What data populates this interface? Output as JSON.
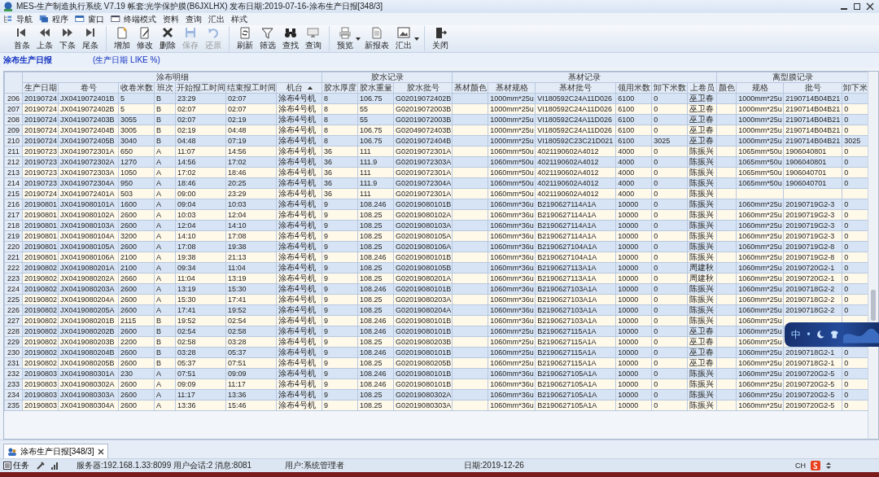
{
  "window": {
    "title": "MES-生产制造执行系统 V7.19 帐套:光学保护膜(B6JXLHX) 发布日期:2019-07-16-涂布生产日报[348/3]"
  },
  "menu": [
    "导航",
    "程序",
    "窗口",
    "终端模式",
    "资料",
    "查询",
    "汇出",
    "样式"
  ],
  "toolbar": [
    {
      "items": [
        {
          "label": "首条",
          "disabled": false,
          "dropdown": false
        },
        {
          "label": "上条",
          "disabled": false,
          "dropdown": false
        },
        {
          "label": "下条",
          "disabled": false,
          "dropdown": false
        },
        {
          "label": "尾条",
          "disabled": false,
          "dropdown": false
        }
      ]
    },
    {
      "items": [
        {
          "label": "增加",
          "disabled": false,
          "dropdown": false
        },
        {
          "label": "修改",
          "disabled": false,
          "dropdown": false
        },
        {
          "label": "删除",
          "disabled": false,
          "dropdown": false
        },
        {
          "label": "保存",
          "disabled": true,
          "dropdown": false
        },
        {
          "label": "还原",
          "disabled": true,
          "dropdown": false
        }
      ]
    },
    {
      "items": [
        {
          "label": "刷新",
          "disabled": false,
          "dropdown": false
        },
        {
          "label": "筛选",
          "disabled": false,
          "dropdown": false
        },
        {
          "label": "查找",
          "disabled": false,
          "dropdown": false
        },
        {
          "label": "查询",
          "disabled": false,
          "dropdown": false
        }
      ]
    },
    {
      "items": [
        {
          "label": "预览",
          "disabled": false,
          "dropdown": true
        },
        {
          "label": "新报表",
          "disabled": false,
          "dropdown": false
        },
        {
          "label": "汇出",
          "disabled": false,
          "dropdown": true
        }
      ]
    },
    {
      "items": [
        {
          "label": "关闭",
          "disabled": false,
          "dropdown": false
        }
      ]
    }
  ],
  "report": {
    "title": "涂布生产日报",
    "filter": "(生产日期 LIKE %)"
  },
  "table": {
    "groups": [
      {
        "label": "涂布明细",
        "columns": [
          {
            "label": "生产日期",
            "sorted": false
          },
          {
            "label": "卷号",
            "sorted": false
          },
          {
            "label": "收卷米数",
            "sorted": false
          },
          {
            "label": "班次",
            "sorted": false
          },
          {
            "label": "开始报工时间",
            "sorted": false
          },
          {
            "label": "结束报工时间",
            "sorted": false
          },
          {
            "label": "机台",
            "sorted": true
          }
        ]
      },
      {
        "label": "胶水记录",
        "columns": [
          {
            "label": "胶水厚度",
            "sorted": false
          },
          {
            "label": "胶水重量",
            "sorted": false
          },
          {
            "label": "胶水批号",
            "sorted": false
          }
        ]
      },
      {
        "label": "基材记录",
        "columns": [
          {
            "label": "基材颜色",
            "sorted": false
          },
          {
            "label": "基材规格",
            "sorted": false
          },
          {
            "label": "基材批号",
            "sorted": false
          },
          {
            "label": "领用米数",
            "sorted": false
          },
          {
            "label": "卸下米数",
            "sorted": false
          },
          {
            "label": "上卷员",
            "sorted": false
          }
        ]
      },
      {
        "label": "离型膜记录",
        "columns": [
          {
            "label": "颜色",
            "sorted": false
          },
          {
            "label": "规格",
            "sorted": false
          },
          {
            "label": "批号",
            "sorted": false
          },
          {
            "label": "卸下米",
            "sorted": false
          }
        ]
      }
    ],
    "rows": [
      {
        "n": "206",
        "cells": [
          "20190724",
          "JX0419072401B",
          "5",
          "B",
          "23:29",
          "02:07",
          "涂布4号机",
          "8",
          "106.75",
          "G02019072402B",
          null,
          "1000mm*25u",
          "VI180592C24A11D026",
          "6100",
          "0",
          "巫卫春",
          null,
          "1000mm*25u",
          "2190714B04B21",
          "0"
        ]
      },
      {
        "n": "207",
        "cells": [
          "20190724",
          "JX0419072402B",
          "5",
          "B",
          "02:07",
          "02:07",
          "涂布4号机",
          "8",
          "55",
          "G02019072003B",
          null,
          "1000mm*25u",
          "VI180592C24A11D026",
          "6100",
          "0",
          "巫卫春",
          null,
          "1000mm*25u",
          "2190714B04B21",
          "0"
        ]
      },
      {
        "n": "208",
        "cells": [
          "20190724",
          "JX0419072403B",
          "3055",
          "B",
          "02:07",
          "02:19",
          "涂布4号机",
          "8",
          "55",
          "G02019072003B",
          null,
          "1000mm*25u",
          "VI180592C24A11D026",
          "6100",
          "0",
          "巫卫春",
          null,
          "1000mm*25u",
          "2190714B04B21",
          "0"
        ]
      },
      {
        "n": "209",
        "cells": [
          "20190724",
          "JX0419072404B",
          "3005",
          "B",
          "02:19",
          "04:48",
          "涂布4号机",
          "8",
          "106.75",
          "G02049072403B",
          null,
          "1000mm*25u",
          "VI180592C24A11D026",
          "6100",
          "0",
          "巫卫春",
          null,
          "1000mm*25u",
          "2190714B04B21",
          "0"
        ]
      },
      {
        "n": "210",
        "cells": [
          "20190724",
          "JX0419072405B",
          "3040",
          "B",
          "04:48",
          "07:19",
          "涂布4号机",
          "8",
          "106.75",
          "G02019072404B",
          null,
          "1000mm*25u",
          "VI180592C23C21D021",
          "6100",
          "3025",
          "巫卫春",
          null,
          "1000mm*25u",
          "2190714B04B21",
          "3025"
        ]
      },
      {
        "n": "211",
        "cells": [
          "20190723",
          "JX0419072301A",
          "650",
          "A",
          "11:07",
          "14:56",
          "涂布4号机",
          "36",
          "111",
          "G02019072301A",
          null,
          "1060mm*50u",
          "4021190602A4012",
          "4000",
          "0",
          "陈振兴",
          null,
          "1065mm*50u",
          "1906040801",
          "0"
        ]
      },
      {
        "n": "212",
        "cells": [
          "20190723",
          "JX0419072302A",
          "1270",
          "A",
          "14:56",
          "17:02",
          "涂布4号机",
          "36",
          "111.9",
          "G02019072303A",
          null,
          "1060mm*50u",
          "4021190602A4012",
          "4000",
          "0",
          "陈振兴",
          null,
          "1065mm*50u",
          "1906040801",
          "0"
        ]
      },
      {
        "n": "213",
        "cells": [
          "20190723",
          "JX0419072303A",
          "1050",
          "A",
          "17:02",
          "18:46",
          "涂布4号机",
          "36",
          "111",
          "G02019072301A",
          null,
          "1060mm*50u",
          "4021190602A4012",
          "4000",
          "0",
          "陈振兴",
          null,
          "1065mm*50u",
          "1906040701",
          "0"
        ]
      },
      {
        "n": "214",
        "cells": [
          "20190723",
          "JX0419072304A",
          "950",
          "A",
          "18:46",
          "20:25",
          "涂布4号机",
          "36",
          "111.9",
          "G02019072304A",
          null,
          "1060mm*50u",
          "4021190602A4012",
          "4000",
          "0",
          "陈振兴",
          null,
          "1065mm*50u",
          "1906040701",
          "0"
        ]
      },
      {
        "n": "215",
        "cells": [
          "20190724",
          "JX0419072401A",
          "503",
          "A",
          "09:00",
          "23:29",
          "涂布4号机",
          "36",
          "111",
          "G02019072301A",
          null,
          "1060mm*50u",
          "4021190602A4012",
          "4000",
          "0",
          "陈振兴",
          null,
          null,
          null,
          null
        ]
      },
      {
        "n": "216",
        "cells": [
          "20190801",
          "JX0419080101A",
          "1600",
          "A",
          "09:04",
          "10:03",
          "涂布4号机",
          "9",
          "108.246",
          "G02019080101B",
          null,
          "1060mm*36u",
          "B2190627114A1A",
          "10000",
          "0",
          "陈振兴",
          null,
          "1060mm*25u",
          "20190719G2-3",
          "0"
        ]
      },
      {
        "n": "217",
        "cells": [
          "20190801",
          "JX0419080102A",
          "2600",
          "A",
          "10:03",
          "12:04",
          "涂布4号机",
          "9",
          "108.25",
          "G02019080102A",
          null,
          "1060mm*36u",
          "B2190627114A1A",
          "10000",
          "0",
          "陈振兴",
          null,
          "1060mm*25u",
          "20190719G2-3",
          "0"
        ]
      },
      {
        "n": "218",
        "cells": [
          "20190801",
          "JX0419080103A",
          "2600",
          "A",
          "12:04",
          "14:10",
          "涂布4号机",
          "9",
          "108.25",
          "G02019080103A",
          null,
          "1060mm*36u",
          "B2190627114A1A",
          "10000",
          "0",
          "陈振兴",
          null,
          "1060mm*25u",
          "20190719G2-3",
          "0"
        ]
      },
      {
        "n": "219",
        "cells": [
          "20190801",
          "JX0419080104A",
          "3200",
          "A",
          "14:10",
          "17:08",
          "涂布4号机",
          "9",
          "108.25",
          "G02019080105A",
          null,
          "1060mm*36u",
          "B2190627114A1A",
          "10000",
          "0",
          "陈振兴",
          null,
          "1060mm*25u",
          "20190719G2-3",
          "0"
        ]
      },
      {
        "n": "220",
        "cells": [
          "20190801",
          "JX0419080105A",
          "2600",
          "A",
          "17:08",
          "19:38",
          "涂布4号机",
          "9",
          "108.25",
          "G02019080106A",
          null,
          "1060mm*36u",
          "B2190627104A1A",
          "10000",
          "0",
          "陈振兴",
          null,
          "1060mm*25u",
          "20190719G2-8",
          "0"
        ]
      },
      {
        "n": "221",
        "cells": [
          "20190801",
          "JX0419080106A",
          "2100",
          "A",
          "19:38",
          "21:13",
          "涂布4号机",
          "9",
          "108.246",
          "G02019080101B",
          null,
          "1060mm*36u",
          "B2190627104A1A",
          "10000",
          "0",
          "陈振兴",
          null,
          "1060mm*25u",
          "20190719G2-8",
          "0"
        ]
      },
      {
        "n": "222",
        "cells": [
          "20190802",
          "JX0419080201A",
          "2100",
          "A",
          "09:34",
          "11:04",
          "涂布4号机",
          "9",
          "108.25",
          "G02019080105B",
          null,
          "1060mm*36u",
          "B2190627113A1A",
          "10000",
          "0",
          "周建秋",
          null,
          "1060mm*25u",
          "20190720G2-1",
          "0"
        ]
      },
      {
        "n": "223",
        "cells": [
          "20190802",
          "JX0419080202A",
          "2660",
          "A",
          "11:04",
          "13:19",
          "涂布4号机",
          "9",
          "108.25",
          "G02019080201A",
          null,
          "1060mm*36u",
          "B2190627113A1A",
          "10000",
          "0",
          "周建秋",
          null,
          "1060mm*25u",
          "20190720G2-1",
          "0"
        ]
      },
      {
        "n": "224",
        "cells": [
          "20190802",
          "JX0419080203A",
          "2600",
          "A",
          "13:19",
          "15:30",
          "涂布4号机",
          "9",
          "108.246",
          "G02019080101B",
          null,
          "1060mm*36u",
          "B2190627103A1A",
          "10000",
          "0",
          "陈振兴",
          null,
          "1060mm*25u",
          "20190718G2-2",
          "0"
        ]
      },
      {
        "n": "225",
        "cells": [
          "20190802",
          "JX0419080204A",
          "2600",
          "A",
          "15:30",
          "17:41",
          "涂布4号机",
          "9",
          "108.25",
          "G02019080203A",
          null,
          "1060mm*36u",
          "B2190627103A1A",
          "10000",
          "0",
          "陈振兴",
          null,
          "1060mm*25u",
          "20190718G2-2",
          "0"
        ]
      },
      {
        "n": "226",
        "cells": [
          "20190802",
          "JX0419080205A",
          "2600",
          "A",
          "17:41",
          "19:52",
          "涂布4号机",
          "9",
          "108.25",
          "G02019080204A",
          null,
          "1060mm*36u",
          "B2190627103A1A",
          "10000",
          "0",
          "陈振兴",
          null,
          "1060mm*25u",
          "20190718G2-2",
          "0"
        ]
      },
      {
        "n": "227",
        "cells": [
          "20190802",
          "JX0419080201B",
          "2115",
          "B",
          "19:52",
          "02:54",
          "涂布4号机",
          "9",
          "108.246",
          "G02019080101B",
          null,
          "1060mm*36u",
          "B2190627103A1A",
          "10000",
          "0",
          "陈振兴",
          null,
          "1060mm*25u",
          null,
          null
        ]
      },
      {
        "n": "228",
        "cells": [
          "20190802",
          "JX0419080202B",
          "2600",
          "B",
          "02:54",
          "02:58",
          "涂布4号机",
          "9",
          "108.246",
          "G02019080101B",
          null,
          "1060mm*25u",
          "B2190627115A1A",
          "10000",
          "0",
          "巫卫春",
          null,
          "1060mm*25u",
          null,
          null
        ]
      },
      {
        "n": "229",
        "cells": [
          "20190802",
          "JX0419080203B",
          "2200",
          "B",
          "02:58",
          "03:28",
          "涂布4号机",
          "9",
          "108.25",
          "G02019080203B",
          null,
          "1060mm*25u",
          "B2190627115A1A",
          "10000",
          "0",
          "巫卫春",
          null,
          "1060mm*25u",
          null,
          null
        ]
      },
      {
        "n": "230",
        "cells": [
          "20190802",
          "JX0419080204B",
          "2600",
          "B",
          "03:28",
          "05:37",
          "涂布4号机",
          "9",
          "108.246",
          "G02019080101B",
          null,
          "1060mm*25u",
          "B2190627115A1A",
          "10000",
          "0",
          "巫卫春",
          null,
          "1060mm*25u",
          "20190718G2-1",
          "0"
        ]
      },
      {
        "n": "231",
        "cells": [
          "20190802",
          "JX0419080205B",
          "2600",
          "B",
          "05:37",
          "07:51",
          "涂布4号机",
          "9",
          "108.25",
          "G02019080205B",
          null,
          "1060mm*25u",
          "B2190627115A1A",
          "10000",
          "0",
          "巫卫春",
          null,
          "1060mm*25u",
          "20190718G2-1",
          "0"
        ]
      },
      {
        "n": "232",
        "cells": [
          "20190803",
          "JX0419080301A",
          "230",
          "A",
          "07:51",
          "09:09",
          "涂布4号机",
          "9",
          "108.246",
          "G02019080101B",
          null,
          "1060mm*36u",
          "B2190627105A1A",
          "10000",
          "0",
          "陈振兴",
          null,
          "1060mm*25u",
          "20190720G2-5",
          "0"
        ]
      },
      {
        "n": "233",
        "cells": [
          "20190803",
          "JX0419080302A",
          "2600",
          "A",
          "09:09",
          "11:17",
          "涂布4号机",
          "9",
          "108.246",
          "G02019080101B",
          null,
          "1060mm*36u",
          "B2190627105A1A",
          "10000",
          "0",
          "陈振兴",
          null,
          "1060mm*25u",
          "20190720G2-5",
          "0"
        ]
      },
      {
        "n": "234",
        "cells": [
          "20190803",
          "JX0419080303A",
          "2600",
          "A",
          "11:17",
          "13:36",
          "涂布4号机",
          "9",
          "108.25",
          "G02019080302A",
          null,
          "1060mm*36u",
          "B2190627105A1A",
          "10000",
          "0",
          "陈振兴",
          null,
          "1060mm*25u",
          "20190720G2-5",
          "0"
        ]
      },
      {
        "n": "235",
        "cells": [
          "20190803",
          "JX0419080304A",
          "2600",
          "A",
          "13:36",
          "15:46",
          "涂布4号机",
          "9",
          "108.25",
          "G02019080303A",
          null,
          "1060mm*36u",
          "B2190627105A1A",
          "10000",
          "0",
          "陈振兴",
          null,
          "1060mm*25u",
          "20190720G2-5",
          "0"
        ]
      }
    ]
  },
  "ime_bar": {
    "mode": "中"
  },
  "tabs": [
    {
      "label": "涂布生产日报[348/3]",
      "selected": true
    }
  ],
  "status_bar": {
    "task": "任务",
    "server": "服务器:192.168.1.33:8099 用户会话:2 消息:8081",
    "user": "用户:系统管理者",
    "date": "日期:2019-12-26",
    "input": "CH"
  }
}
